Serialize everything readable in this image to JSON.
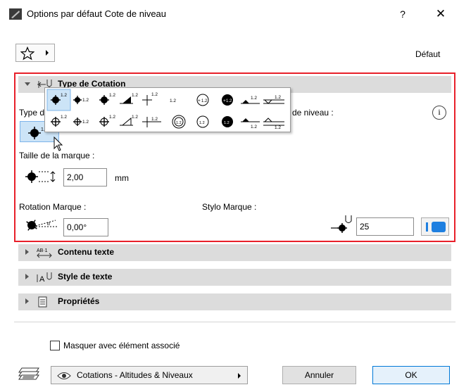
{
  "window": {
    "title": "Options par défaut Cote de niveau",
    "help_label": "?",
    "close_label": "✕"
  },
  "toolbar": {
    "favorites_icon": "star-icon",
    "default_label": "Défaut"
  },
  "panels": {
    "cotation": {
      "label": "Type de Cotation",
      "expanded": true,
      "type_label_partial": "Type d",
      "level_label_partial": "de niveau :",
      "marker_size_label": "Taille de la marque :",
      "marker_size_value": "2,00",
      "marker_size_unit": "mm",
      "rotation_label": "Rotation Marque :",
      "rotation_value": "0,00°",
      "pen_label": "Stylo Marque :",
      "pen_value": "25",
      "marker_popup_value_text": "1.2",
      "marker_selected_index": 0
    },
    "contenu": {
      "label": "Contenu texte",
      "expanded": false
    },
    "style": {
      "label": "Style de texte",
      "expanded": false
    },
    "proprietes": {
      "label": "Propriétés",
      "expanded": false
    }
  },
  "footer": {
    "hide_with_element_label": "Masquer avec élément associé",
    "hide_with_element_checked": false,
    "layer_value": "Cotations - Altitudes & Niveaux",
    "cancel_label": "Annuler",
    "ok_label": "OK"
  },
  "colors": {
    "highlight_frame": "#e8202a",
    "selection_bg": "#cce4f7",
    "pen_swatch": "#1e7fe0",
    "panel_header": "#dcdcdc"
  }
}
